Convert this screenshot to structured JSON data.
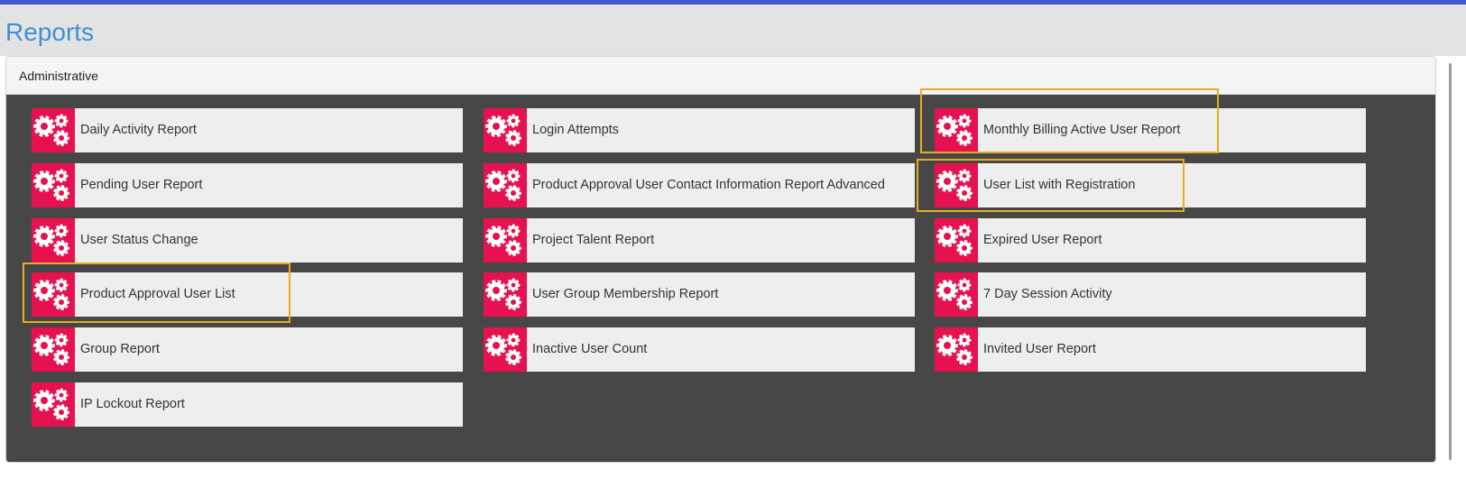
{
  "colors": {
    "accent_bar": "#3f5bcc",
    "title": "#3e8fd6",
    "icon_bg": "#e5124f",
    "panel_body": "#474747",
    "highlight": "#e8ac24"
  },
  "page": {
    "title": "Reports"
  },
  "panel": {
    "title": "Administrative"
  },
  "reports": [
    {
      "label": "Daily Activity Report",
      "icon": "gears-icon",
      "highlighted": false
    },
    {
      "label": "Login Attempts",
      "icon": "gears-icon",
      "highlighted": false
    },
    {
      "label": "Monthly Billing Active User Report",
      "icon": "gears-icon",
      "highlighted": true
    },
    {
      "label": "Pending User Report",
      "icon": "gears-icon",
      "highlighted": false
    },
    {
      "label": "Product Approval User Contact Information Report Advanced",
      "icon": "gears-icon",
      "highlighted": false
    },
    {
      "label": "User List with Registration",
      "icon": "gears-icon",
      "highlighted": true
    },
    {
      "label": "User Status Change",
      "icon": "gears-icon",
      "highlighted": false
    },
    {
      "label": "Project Talent Report",
      "icon": "gears-icon",
      "highlighted": false
    },
    {
      "label": "Expired User Report",
      "icon": "gears-icon",
      "highlighted": false
    },
    {
      "label": "Product Approval User List",
      "icon": "gears-icon",
      "highlighted": true
    },
    {
      "label": "User Group Membership Report",
      "icon": "gears-icon",
      "highlighted": false
    },
    {
      "label": "7 Day Session Activity",
      "icon": "gears-icon",
      "highlighted": false
    },
    {
      "label": "Group Report",
      "icon": "gears-icon",
      "highlighted": false
    },
    {
      "label": "Inactive User Count",
      "icon": "gears-icon",
      "highlighted": false
    },
    {
      "label": "Invited User Report",
      "icon": "gears-icon",
      "highlighted": false
    },
    {
      "label": "IP Lockout Report",
      "icon": "gears-icon",
      "highlighted": false
    }
  ]
}
